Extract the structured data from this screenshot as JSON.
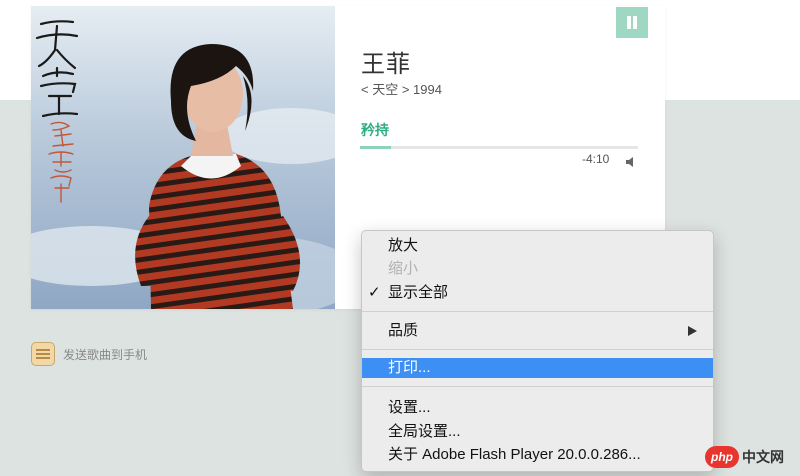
{
  "player": {
    "artist": "王菲",
    "album_line": "< 天空 > 1994",
    "song": "矜持",
    "time_remaining": "-4:10",
    "progress": 0.11,
    "pause_icon": "pause-icon",
    "volume_icon": "volume-icon",
    "accent_color": "#2fae86",
    "cover_text": "天空"
  },
  "send_to_phone": {
    "label": "发送歌曲到手机",
    "icon": "phone-radio-icon"
  },
  "context_menu": {
    "zoom_in": "放大",
    "zoom_out": "缩小",
    "show_all": "显示全部",
    "check": "✓",
    "quality": "品质",
    "print": "打印...",
    "settings": "设置...",
    "global_settings": "全局设置...",
    "about": "关于 Adobe Flash Player 20.0.0.286...",
    "highlight_color": "#3d8ff4"
  },
  "watermark": {
    "badge": "php",
    "text": "中文网"
  }
}
